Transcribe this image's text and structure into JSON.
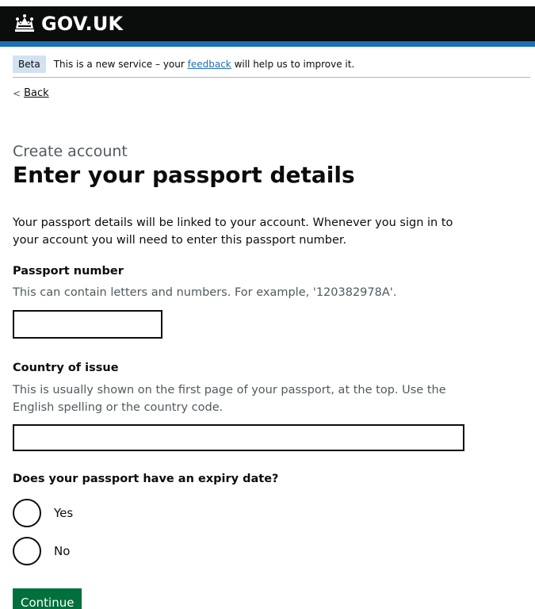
{
  "header": {
    "logo_text": "GOV.UK"
  },
  "phase_banner": {
    "tag": "Beta",
    "text_before": "This is a new service – your ",
    "link_text": "feedback",
    "text_after": " will help us to improve it."
  },
  "back_link": {
    "label": "Back"
  },
  "page": {
    "caption": "Create account",
    "title": "Enter your passport details",
    "intro": "Your passport details will be linked to your account. Whenever you sign in to your account you will need to enter this passport number."
  },
  "passport_number": {
    "label": "Passport number",
    "hint": "This can contain letters and numbers. For example, '120382978A'.",
    "value": ""
  },
  "country_of_issue": {
    "label": "Country of issue",
    "hint": "This is usually shown on the first page of your passport, at the top. Use the English spelling or the country code.",
    "value": ""
  },
  "expiry": {
    "question": "Does your passport have an expiry date?",
    "options": [
      {
        "label": "Yes"
      },
      {
        "label": "No"
      }
    ]
  },
  "continue_button": {
    "label": "Continue"
  },
  "colors": {
    "header_bg": "#0b0c0c",
    "header_bar": "#1d70b8",
    "tag_bg": "#d2e2f1",
    "link": "#1d70b8",
    "button_bg": "#00703c"
  },
  "icons": {
    "logo": "crown-icon",
    "back": "chevron-left-icon"
  }
}
